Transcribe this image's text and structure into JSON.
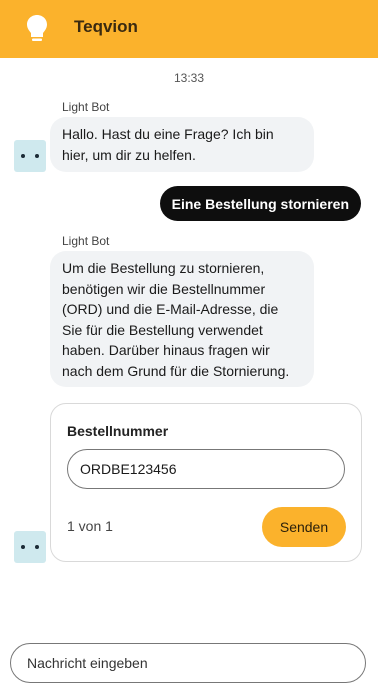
{
  "header": {
    "title": "Teqvion",
    "logo_icon": "lightbulb-icon",
    "background_color": "#fbb22c"
  },
  "chat": {
    "timestamp": "13:33",
    "messages": [
      {
        "role": "bot",
        "sender": "Light Bot",
        "text": "Hallo. Hast du eine Frage? Ich bin hier, um dir zu helfen."
      },
      {
        "role": "user",
        "text": "Eine Bestellung stornieren"
      },
      {
        "role": "bot",
        "sender": "Light Bot",
        "text": "Um die Bestellung zu stornieren, benötigen wir die Bestellnummer (ORD) und die E-Mail-Adresse, die Sie für die Bestellung verwendet haben. Darüber hinaus fragen wir nach dem Grund für die Stornierung."
      }
    ],
    "form_card": {
      "label": "Bestellnummer",
      "input_value": "ORDBE123456",
      "pager": "1 von 1",
      "submit_label": "Senden"
    }
  },
  "composer": {
    "placeholder": "Nachricht eingeben"
  },
  "colors": {
    "accent": "#fbb22c",
    "user_bubble": "#0e0e0e",
    "bot_bubble": "#f1f3f5",
    "avatar": "#cfe9ee"
  }
}
